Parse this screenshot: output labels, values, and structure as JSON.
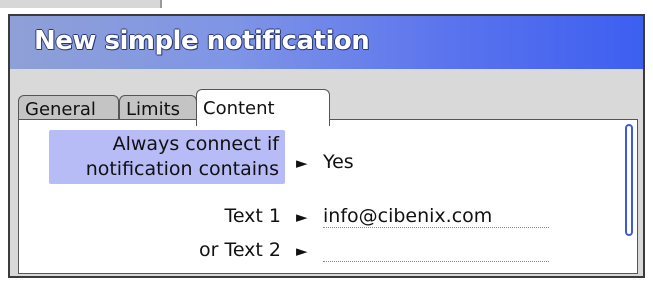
{
  "dialog": {
    "title": "New simple notification"
  },
  "tabs": [
    {
      "label": "General",
      "active": false
    },
    {
      "label": "Limits",
      "active": false
    },
    {
      "label": "Content",
      "active": true
    }
  ],
  "content": {
    "rows": [
      {
        "label_line1": "Always connect if",
        "label_line2": "notification contains",
        "arrow": "►",
        "value": "Yes"
      },
      {
        "label": "Text 1",
        "arrow": "►",
        "value": "info@cibenix.com"
      },
      {
        "label": "or Text 2",
        "arrow": "►",
        "value": ""
      }
    ]
  },
  "colors": {
    "title_gradient_start": "#8fa0d6",
    "title_gradient_end": "#3d5ff0",
    "highlight": "#b7bcf6",
    "scrollbar": "#3f5bd8"
  }
}
